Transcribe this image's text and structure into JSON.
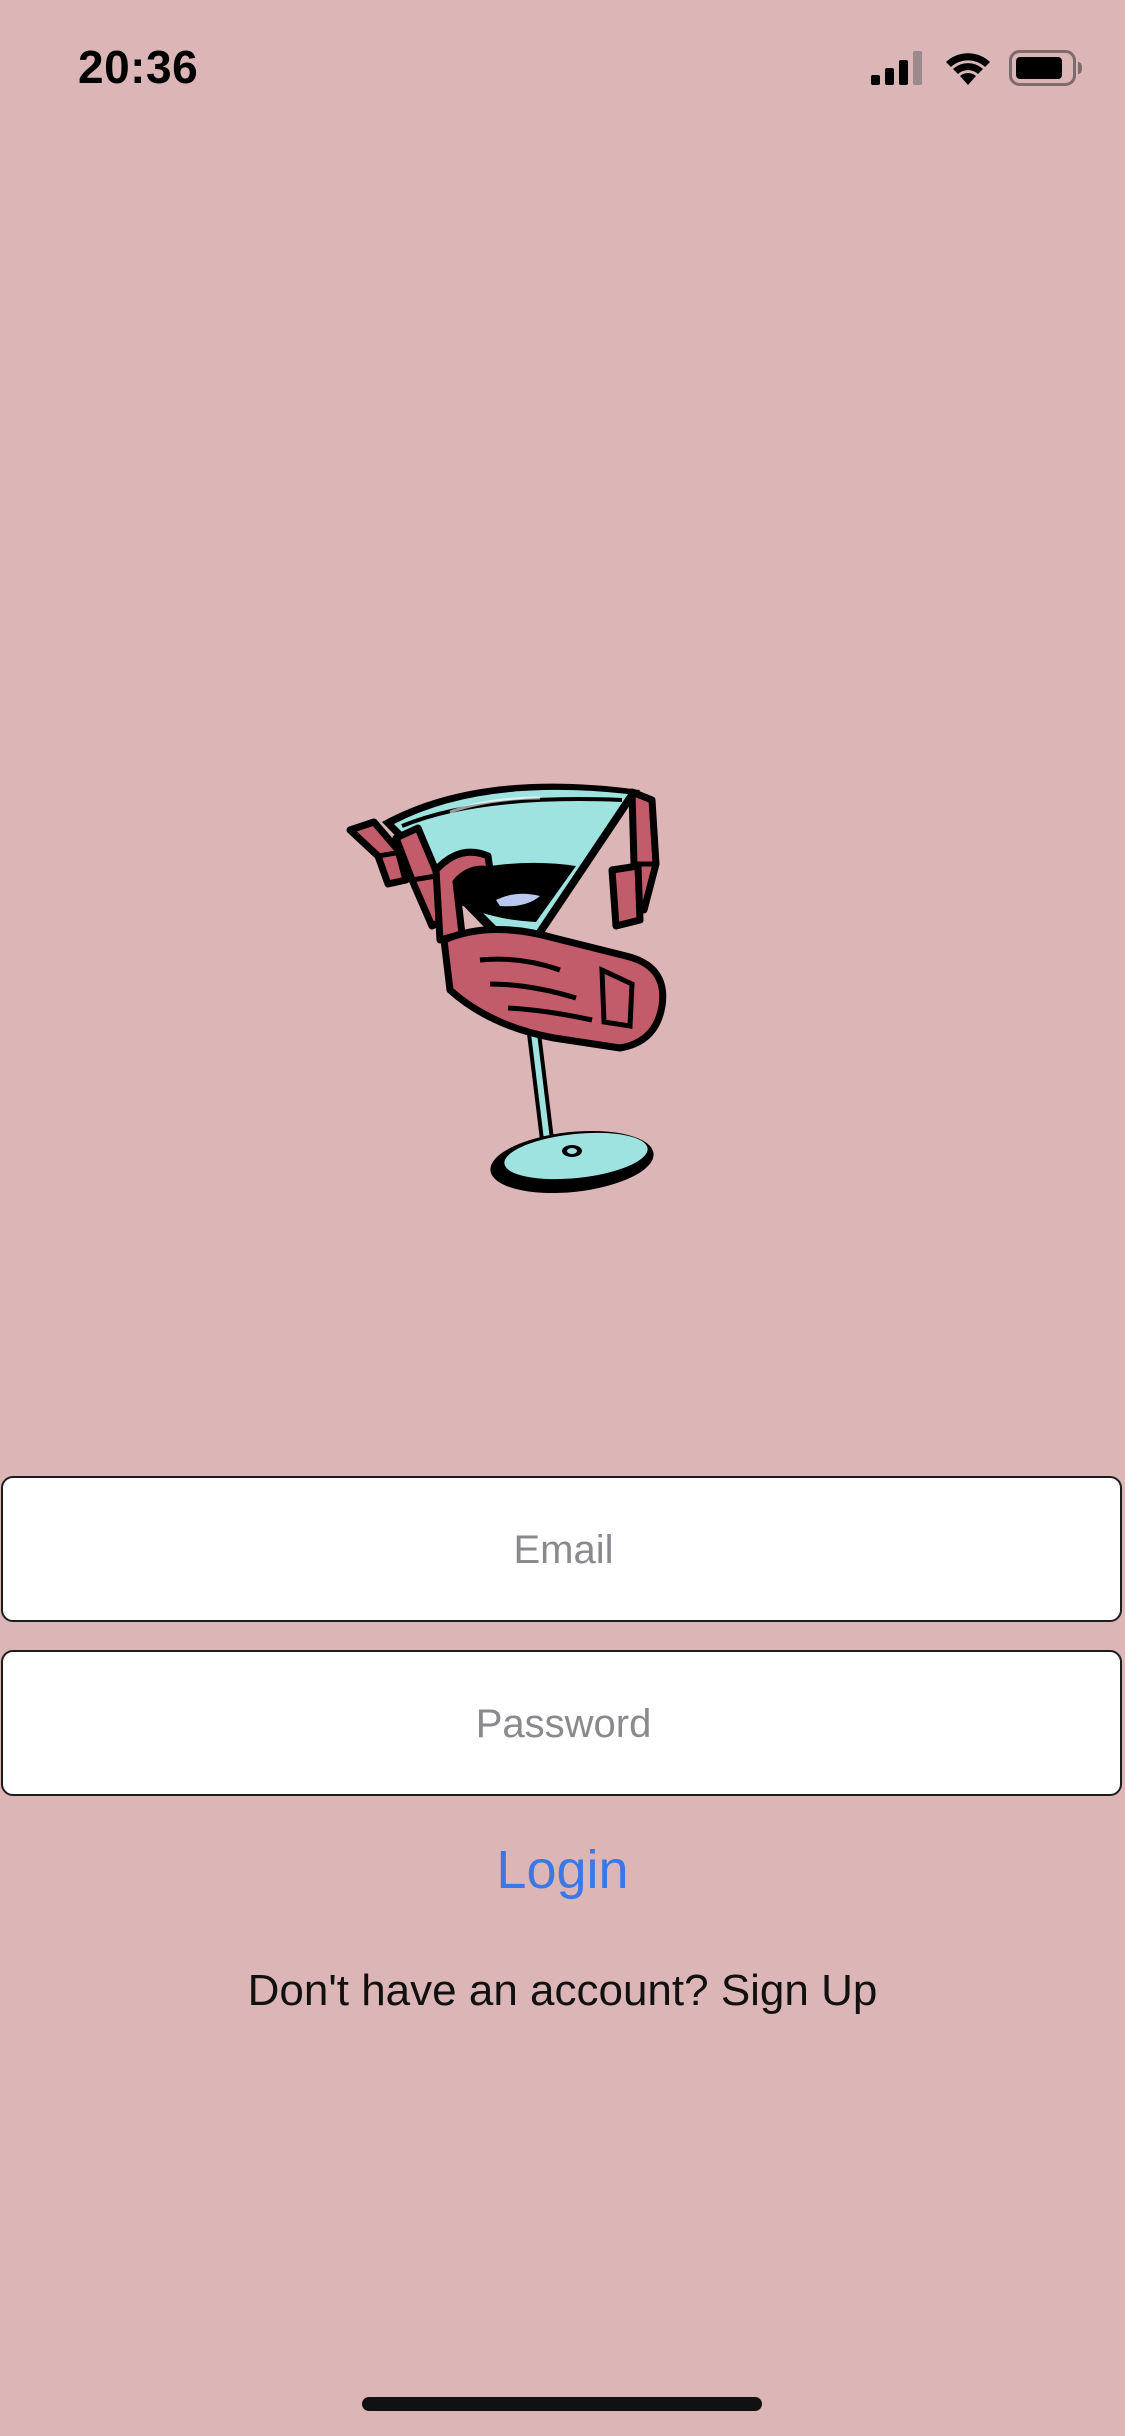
{
  "status_bar": {
    "time": "20:36",
    "icons": [
      "cellular-signal-icon",
      "wifi-icon",
      "battery-icon"
    ]
  },
  "logo": {
    "icon": "skeleton-hand-martini-logo",
    "colors": {
      "glass": "#9fe3e1",
      "bone": "#c25b6a",
      "outline": "#000000"
    }
  },
  "login_form": {
    "email_placeholder": "Email",
    "email_value": "",
    "password_placeholder": "Password",
    "password_value": "",
    "login_label": "Login",
    "signup_prompt": "Don't have an account? Sign Up"
  },
  "colors": {
    "background": "#dcb6b7",
    "accent": "#3b78e7"
  }
}
